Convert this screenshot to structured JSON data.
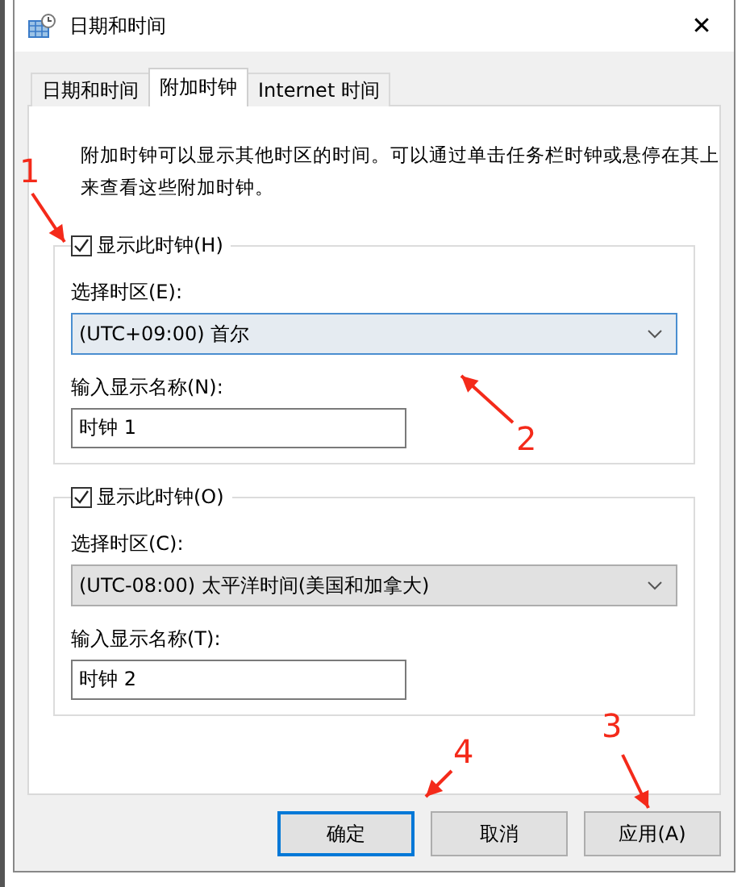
{
  "window": {
    "title": "日期和时间",
    "close": "✕"
  },
  "tabs": [
    {
      "label": "日期和时间",
      "selected": false
    },
    {
      "label": "附加时钟",
      "selected": true
    },
    {
      "label": "Internet 时间",
      "selected": false
    }
  ],
  "description": "附加时钟可以显示其他时区的时间。可以通过单击任务栏时钟或悬停在其上来查看这些附加时钟。",
  "clocks": [
    {
      "show_label": "显示此时钟(H)",
      "checked": true,
      "zone_label": "选择时区(E):",
      "zone": "(UTC+09:00) 首尔",
      "focused": true,
      "name_label": "输入显示名称(N):",
      "name": "时钟 1"
    },
    {
      "show_label": "显示此时钟(O)",
      "checked": true,
      "zone_label": "选择时区(C):",
      "zone": "(UTC-08:00) 太平洋时间(美国和加拿大)",
      "focused": false,
      "name_label": "输入显示名称(T):",
      "name": "时钟 2"
    }
  ],
  "buttons": [
    {
      "label": "确定",
      "default": true
    },
    {
      "label": "取消",
      "default": false
    },
    {
      "label": "应用(A)",
      "default": false
    }
  ],
  "annotations": [
    {
      "label": "1"
    },
    {
      "label": "2"
    },
    {
      "label": "3"
    },
    {
      "label": "4"
    }
  ]
}
